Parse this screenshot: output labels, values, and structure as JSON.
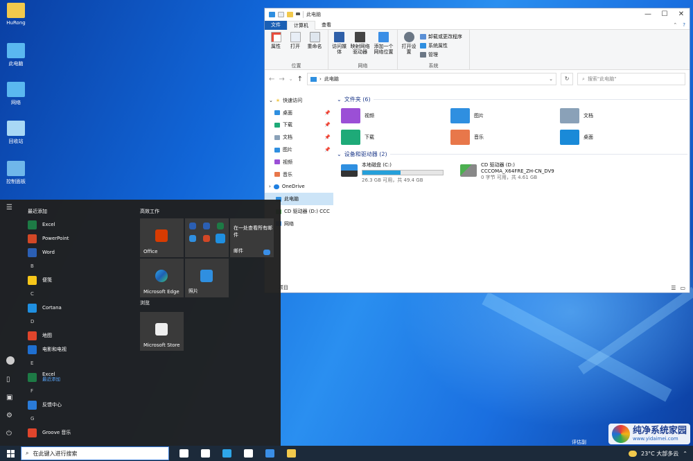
{
  "desktop": {
    "icons": [
      {
        "label": "HuRong",
        "icon": "user-folder-icon",
        "color": "#f2c94c"
      },
      {
        "label": "此电脑",
        "icon": "computer-icon",
        "color": "#5ab8f0"
      },
      {
        "label": "网络",
        "icon": "network-icon",
        "color": "#5ab8f0"
      },
      {
        "label": "回收站",
        "icon": "recycle-bin-icon",
        "color": "#a8d8f5"
      },
      {
        "label": "控制面板",
        "icon": "control-panel-icon",
        "color": "#6fb7ea"
      }
    ]
  },
  "explorer": {
    "title": "此电脑",
    "controls": {
      "minimize": "—",
      "maximize": "☐",
      "close": "✕"
    },
    "tabs": {
      "file": "文件",
      "computer": "计算机",
      "view": "查看"
    },
    "ribbon": {
      "location": {
        "label": "位置",
        "buttons": [
          "属性",
          "打开",
          "重命名"
        ]
      },
      "network": {
        "label": "网络",
        "buttons": [
          "访问媒体",
          "映射网络驱动器",
          "添加一个网络位置"
        ]
      },
      "system": {
        "label": "系统",
        "open_settings": "打开设置",
        "items": [
          "卸载或更改程序",
          "系统属性",
          "管理"
        ]
      }
    },
    "address": {
      "path": "此电脑",
      "search_placeholder": "搜索\"此电脑\""
    },
    "nav": {
      "quick_access": "快速访问",
      "items": [
        "桌面",
        "下载",
        "文档",
        "图片",
        "视频",
        "音乐"
      ],
      "onedrive": "OneDrive",
      "this_pc": "此电脑",
      "cd": "CD 驱动器 (D:) CCC",
      "network": "网络"
    },
    "folders_header": "文件夹 (6)",
    "folders": [
      {
        "name": "视频",
        "icon": "videos-folder-icon",
        "color": "#9b4fd6"
      },
      {
        "name": "图片",
        "icon": "pictures-folder-icon",
        "color": "#2f8fe0"
      },
      {
        "name": "文档",
        "icon": "documents-folder-icon",
        "color": "#8aa1b8"
      },
      {
        "name": "下载",
        "icon": "downloads-folder-icon",
        "color": "#1eaa78"
      },
      {
        "name": "音乐",
        "icon": "music-folder-icon",
        "color": "#e8774a"
      },
      {
        "name": "桌面",
        "icon": "desktop-folder-icon",
        "color": "#1a8ad8"
      }
    ],
    "drives_header": "设备和驱动器 (2)",
    "drives": [
      {
        "name": "本地磁盘 (C:)",
        "sub": "26.3 GB 可用，共 49.4 GB",
        "used_fraction": 0.47
      },
      {
        "name": "CD 驱动器 (D:)",
        "name2": "CCCOMA_X64FRE_ZH-CN_DV9",
        "sub": "0 字节 可用，共 4.61 GB"
      }
    ],
    "status": "项目"
  },
  "start": {
    "recent_header": "最近添加",
    "groups": [
      {
        "letter": null,
        "apps": [
          {
            "name": "Excel",
            "color": "#1d7a45"
          },
          {
            "name": "PowerPoint",
            "color": "#d24726"
          },
          {
            "name": "Word",
            "color": "#2b5fb4"
          }
        ]
      },
      {
        "letter": "B",
        "apps": [
          {
            "name": "便笺",
            "color": "#f7c71a"
          }
        ]
      },
      {
        "letter": "C",
        "apps": [
          {
            "name": "Cortana",
            "color": "#1f8fe0"
          }
        ]
      },
      {
        "letter": "D",
        "apps": [
          {
            "name": "地图",
            "color": "#e0452c"
          },
          {
            "name": "电影和电视",
            "color": "#1f6fd0"
          }
        ]
      },
      {
        "letter": "E",
        "apps": [
          {
            "name": "Excel",
            "sub": "最近添加",
            "color": "#1d7a45"
          }
        ]
      },
      {
        "letter": "F",
        "apps": [
          {
            "name": "反馈中心",
            "color": "#2a7bd8"
          }
        ]
      },
      {
        "letter": "G",
        "apps": [
          {
            "name": "Groove 音乐",
            "color": "#e0452c"
          }
        ]
      }
    ],
    "tiles_header": "高效工作",
    "tiles": {
      "office": "Office",
      "mail_text": "在一处查看所有邮件",
      "mail": "邮件",
      "edge": "Microsoft Edge",
      "photos": "照片",
      "browse_header": "浏览",
      "store": "Microsoft Store"
    }
  },
  "taskbar": {
    "search_placeholder": "在此键入进行搜索",
    "weather": "23°C 大部多云",
    "apps": [
      {
        "icon": "cortana-icon",
        "color": "#ffffff"
      },
      {
        "icon": "task-view-icon",
        "color": "#ffffff"
      },
      {
        "icon": "edge-icon",
        "color": "#2ea6e8"
      },
      {
        "icon": "store-icon",
        "color": "#ffffff"
      },
      {
        "icon": "mail-icon",
        "color": "#3a8ee6"
      },
      {
        "icon": "file-explorer-icon",
        "color": "#f2c94c"
      }
    ]
  },
  "overlay": {
    "eval_text": "评估副",
    "wm_title": "纯净系统家园",
    "wm_url": "www.yidaimei.com"
  }
}
